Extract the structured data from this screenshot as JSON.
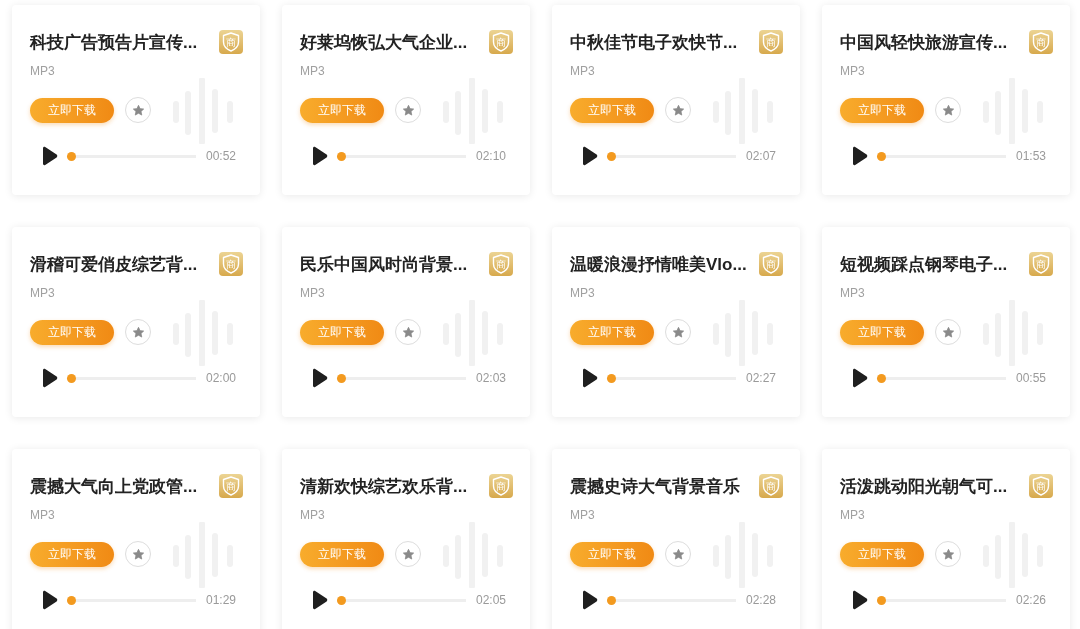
{
  "tracks": [
    {
      "title": "科技广告预告片宣传...",
      "badge": "商",
      "format": "MP3",
      "download_label": "立即下载",
      "favorited": false,
      "level": 0,
      "duration": "00:52"
    },
    {
      "title": "好莱坞恢弘大气企业...",
      "badge": "商",
      "format": "MP3",
      "download_label": "立即下载",
      "favorited": false,
      "level": 0,
      "duration": "02:10"
    },
    {
      "title": "中秋佳节电子欢快节...",
      "badge": "商",
      "format": "MP3",
      "download_label": "立即下载",
      "favorited": false,
      "level": 0,
      "duration": "02:07"
    },
    {
      "title": "中国风轻快旅游宣传...",
      "badge": "商",
      "format": "MP3",
      "download_label": "立即下载",
      "favorited": false,
      "level": 0,
      "duration": "01:53"
    },
    {
      "title": "滑稽可爱俏皮综艺背...",
      "badge": "商",
      "format": "MP3",
      "download_label": "立即下载",
      "favorited": false,
      "level": 0,
      "duration": "02:00"
    },
    {
      "title": "民乐中国风时尚背景...",
      "badge": "商",
      "format": "MP3",
      "download_label": "立即下载",
      "favorited": false,
      "level": 0,
      "duration": "02:03"
    },
    {
      "title": "温暖浪漫抒情唯美Vlo...",
      "badge": "商",
      "format": "MP3",
      "download_label": "立即下载",
      "favorited": false,
      "level": 0,
      "duration": "02:27"
    },
    {
      "title": "短视频踩点钢琴电子...",
      "badge": "商",
      "format": "MP3",
      "download_label": "立即下载",
      "favorited": false,
      "level": 0,
      "duration": "00:55"
    },
    {
      "title": "震撼大气向上党政管...",
      "badge": "商",
      "format": "MP3",
      "download_label": "立即下载",
      "favorited": false,
      "level": 0,
      "duration": "01:29"
    },
    {
      "title": "清新欢快综艺欢乐背...",
      "badge": "商",
      "format": "MP3",
      "download_label": "立即下载",
      "favorited": false,
      "level": 0,
      "duration": "02:05"
    },
    {
      "title": "震撼史诗大气背景音乐",
      "badge": "商",
      "format": "MP3",
      "download_label": "立即下载",
      "favorited": false,
      "level": 0,
      "duration": "02:28"
    },
    {
      "title": "活泼跳动阳光朝气可...",
      "badge": "商",
      "format": "MP3",
      "download_label": "立即下载",
      "favorited": false,
      "level": 0,
      "duration": "02:26"
    }
  ]
}
